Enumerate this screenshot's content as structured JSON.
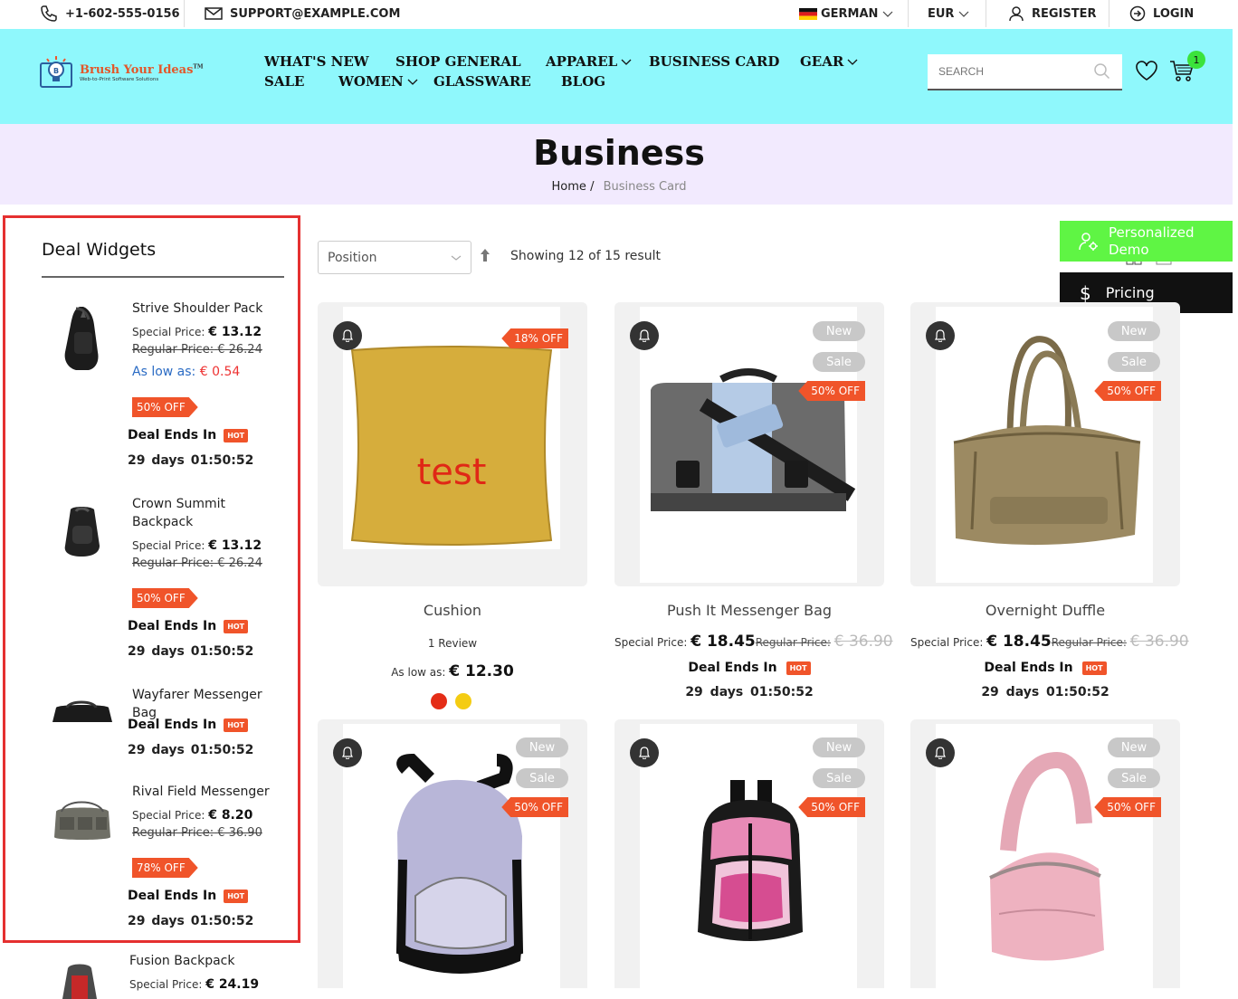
{
  "topbar": {
    "phone": "+1-602-555-0156",
    "email": "SUPPORT@EXAMPLE.COM",
    "language": "GERMAN",
    "currency": "EUR",
    "register": "REGISTER",
    "login": "LOGIN"
  },
  "header": {
    "logo_name": "Brush Your Ideas",
    "logo_tm": "TM",
    "logo_tagline": "Web-to-Print Software Solutions",
    "nav": {
      "whats_new": "WHAT'S NEW",
      "shop_general": "SHOP GENERAL",
      "apparel": "APPAREL",
      "business_card": "BUSINESS CARD",
      "gear": "GEAR",
      "sale": "SALE",
      "women": "WOMEN",
      "glassware": "GLASSWARE",
      "blog": "BLOG"
    },
    "search_placeholder": "SEARCH",
    "cart_count": "1"
  },
  "page": {
    "title": "Business",
    "breadcrumb_home": "Home",
    "breadcrumb_sep": "/",
    "breadcrumb_current": "Business Card"
  },
  "sidebar": {
    "title": "Deal Widgets",
    "deal_ends_label": "Deal Ends In",
    "hot_label": "HOT",
    "special_label": "Special Price:",
    "regular_label": "Regular Price:",
    "items": [
      {
        "name": "Strive Shoulder Pack",
        "special": "€ 13.12",
        "regular": "€ 26.24",
        "as_low_label": "As low as:",
        "as_low": "€ 0.54",
        "off": "50% OFF",
        "countdown": "29 days  01:50:52"
      },
      {
        "name": "Crown Summit Backpack",
        "special": "€ 13.12",
        "regular": "€ 26.24",
        "off": "50% OFF",
        "countdown": "29 days  01:50:52"
      },
      {
        "name": "Wayfarer Messenger Bag",
        "countdown": "29 days  01:50:52"
      },
      {
        "name": "Rival Field Messenger",
        "special": "€ 8.20",
        "regular": "€ 36.90",
        "off": "78% OFF",
        "countdown": "29 days  01:50:52"
      },
      {
        "name": "Fusion Backpack",
        "special": "€ 24.19"
      }
    ]
  },
  "toolbar": {
    "sort_value": "Position",
    "showing": "Showing 12 of 15 result"
  },
  "floaters": {
    "demo": "Personalized Demo",
    "pricing": "Pricing"
  },
  "products": [
    {
      "name": "Cushion",
      "off": "18% OFF",
      "review": "1 Review",
      "as_low_label": "As low as:",
      "price": "€ 12.30",
      "image_text": "test",
      "swatches": [
        "#e42d17",
        "#f4cc12"
      ]
    },
    {
      "name": "Push It Messenger Bag",
      "new": "New",
      "sale": "Sale",
      "off": "50% OFF",
      "special_label": "Special Price:",
      "special": "€ 18.45",
      "regular_label": "Regular Price:",
      "regular": "€ 36.90",
      "deal": "Deal Ends In",
      "countdown": "29 days  01:50:52"
    },
    {
      "name": "Overnight Duffle",
      "new": "New",
      "sale": "Sale",
      "off": "50% OFF",
      "special_label": "Special Price:",
      "special": "€ 18.45",
      "regular_label": "Regular Price:",
      "regular": "€ 36.90",
      "deal": "Deal Ends In",
      "countdown": "29 days  01:50:52"
    },
    {
      "new": "New",
      "sale": "Sale",
      "off": "50% OFF"
    },
    {
      "new": "New",
      "sale": "Sale",
      "off": "50% OFF"
    },
    {
      "new": "New",
      "sale": "Sale",
      "off": "50% OFF"
    }
  ],
  "colors": {
    "header_bg": "#8ff8fc",
    "band_bg": "#f2eafe",
    "accent_orange": "#f0542a",
    "sidebar_border": "#e53030",
    "demo_green": "#5ff544"
  }
}
